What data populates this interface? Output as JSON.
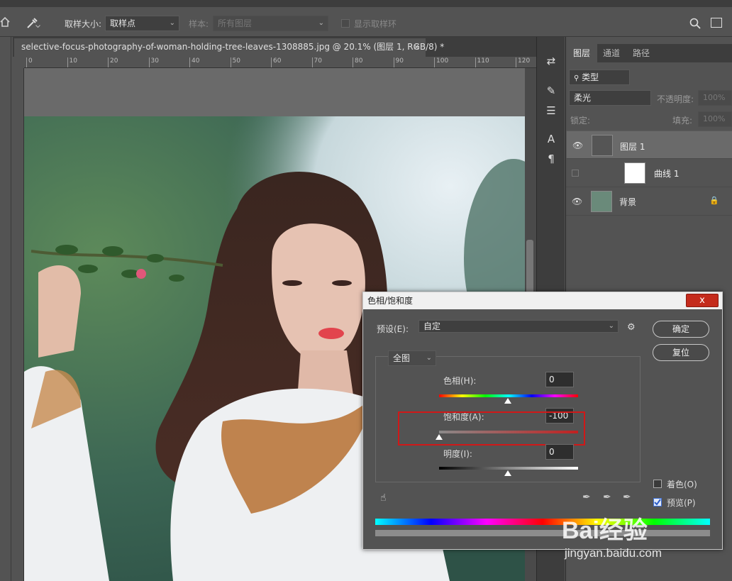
{
  "options_bar": {
    "sample_size_label": "取样大小:",
    "sample_size_value": "取样点",
    "sample_label": "样本:",
    "sample_value": "所有图层",
    "show_ring_label": "显示取样环"
  },
  "document": {
    "tab_title": "selective-focus-photography-of-woman-holding-tree-leaves-1308885.jpg @ 20.1% (图层 1, RGB/8) *",
    "close_glyph": "×",
    "ruler_ticks": [
      "0",
      "10",
      "20",
      "30",
      "40",
      "50",
      "60",
      "70",
      "80",
      "90",
      "100",
      "110",
      "120"
    ]
  },
  "layers_panel": {
    "tabs": [
      "图层",
      "通道",
      "路径"
    ],
    "filter_kind": "类型",
    "blend_mode": "柔光",
    "opacity_label": "不透明度:",
    "opacity_value": "100%",
    "lock_label": "锁定:",
    "fill_label": "填充:",
    "fill_value": "100%",
    "layers": [
      {
        "name": "图层 1",
        "visible": true,
        "selected": true
      },
      {
        "name": "曲线 1",
        "visible": false,
        "selected": false
      },
      {
        "name": "背景",
        "visible": true,
        "selected": false
      }
    ]
  },
  "dialog": {
    "title": "色相/饱和度",
    "close_glyph": "x",
    "preset_label": "预设(E):",
    "preset_value": "自定",
    "channel_value": "全图",
    "hue_label": "色相(H):",
    "hue_value": "0",
    "saturation_label": "饱和度(A):",
    "saturation_value": "-100",
    "lightness_label": "明度(I):",
    "lightness_value": "0",
    "ok_label": "确定",
    "reset_label": "复位",
    "colorize_label": "着色(O)",
    "colorize_checked": false,
    "preview_label": "预览(P)",
    "preview_checked": true,
    "slider_levels": {
      "hue": 0,
      "saturation": -100,
      "lightness": 0
    }
  },
  "watermark": {
    "brand": "Bai经验",
    "url": "jingyan.baidu.com"
  }
}
